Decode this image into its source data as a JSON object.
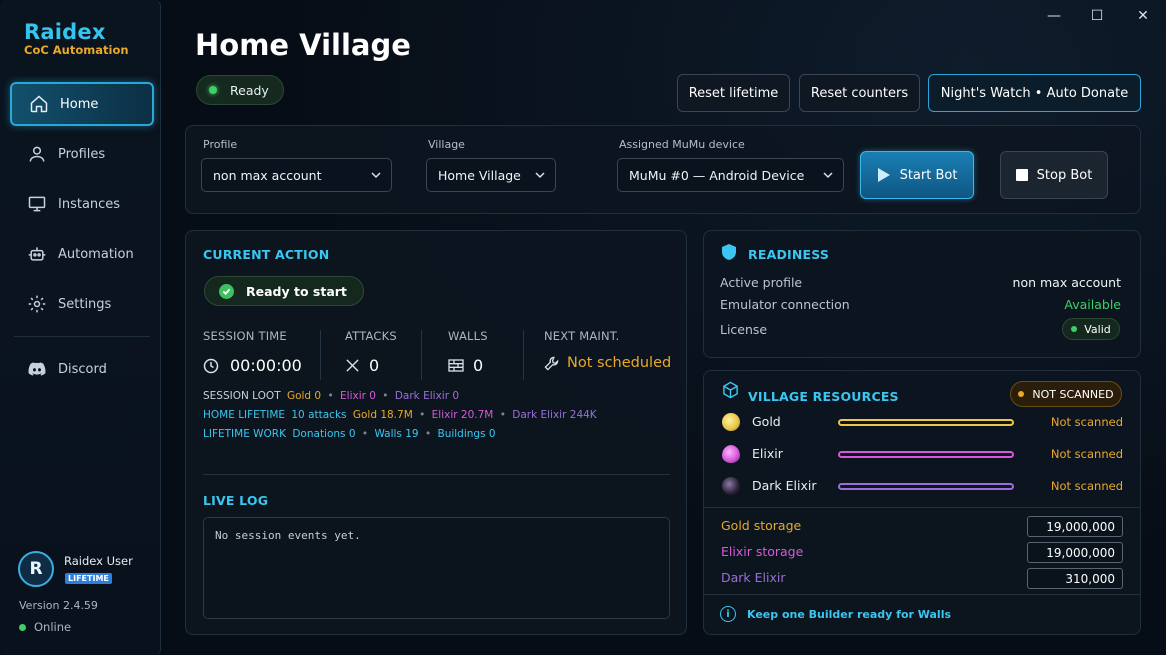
{
  "brand": {
    "name": "Raidex",
    "subtitle": "CoC Automation"
  },
  "nav": {
    "items": [
      {
        "label": "Home",
        "icon": "home-icon",
        "active": true
      },
      {
        "label": "Profiles",
        "icon": "user-icon"
      },
      {
        "label": "Instances",
        "icon": "monitor-icon"
      },
      {
        "label": "Automation",
        "icon": "robot-icon"
      },
      {
        "label": "Settings",
        "icon": "gear-icon"
      }
    ],
    "discord": {
      "label": "Discord",
      "icon": "discord-icon"
    }
  },
  "user": {
    "avatar_letter": "R",
    "name": "Raidex User",
    "badge": "LIFETIME",
    "version": "Version 2.4.59",
    "status": "Online"
  },
  "window": {
    "minimize": "—",
    "maximize": "☐",
    "close": "✕"
  },
  "header": {
    "title": "Home Village",
    "status": "Ready",
    "buttons": {
      "reset_lifetime": "Reset lifetime",
      "reset_counters": "Reset counters",
      "nights_watch": "Night's Watch • Auto Donate"
    }
  },
  "controls": {
    "profile": {
      "label": "Profile",
      "value": "non max account"
    },
    "village": {
      "label": "Village",
      "value": "Home Village"
    },
    "device": {
      "label": "Assigned MuMu device",
      "value": "MuMu #0 — Android Device"
    },
    "start": "Start Bot",
    "stop": "Stop Bot"
  },
  "current_action": {
    "title": "CURRENT ACTION",
    "state": "Ready to start",
    "stats": {
      "session_time": {
        "label": "SESSION TIME",
        "value": "00:00:00"
      },
      "attacks": {
        "label": "ATTACKS",
        "value": "0"
      },
      "walls": {
        "label": "WALLS",
        "value": "0"
      },
      "next_maint": {
        "label": "NEXT MAINT.",
        "value": "Not scheduled"
      }
    },
    "session_loot": {
      "label": "SESSION LOOT",
      "gold": "Gold 0",
      "elixir": "Elixir 0",
      "dark": "Dark Elixir 0"
    },
    "home_lifetime": {
      "label": "HOME LIFETIME",
      "attacks": "10 attacks",
      "gold": "Gold 18.7M",
      "elixir": "Elixir 20.7M",
      "dark": "Dark Elixir 244K"
    },
    "lifetime_work": {
      "label": "LIFETIME WORK",
      "donations": "Donations 0",
      "walls": "Walls 19",
      "buildings": "Buildings 0"
    },
    "separator": "•"
  },
  "live_log": {
    "title": "LIVE LOG",
    "text": "No session events yet."
  },
  "readiness": {
    "title": "READINESS",
    "active_profile": {
      "label": "Active profile",
      "value": "non max account"
    },
    "emulator": {
      "label": "Emulator connection",
      "value": "Available"
    },
    "license": {
      "label": "License",
      "value": "Valid"
    }
  },
  "resources": {
    "title": "VILLAGE RESOURCES",
    "scan_state": "NOT SCANNED",
    "items": [
      {
        "name": "Gold",
        "status": "Not scanned",
        "color": "#e9c84a"
      },
      {
        "name": "Elixir",
        "status": "Not scanned",
        "color": "#d65ad8"
      },
      {
        "name": "Dark Elixir",
        "status": "Not scanned",
        "color": "#9a6fd8"
      }
    ],
    "storage": [
      {
        "label": "Gold storage",
        "value": "19,000,000",
        "color": "#e9c84a"
      },
      {
        "label": "Elixir storage",
        "value": "19,000,000",
        "color": "#d65ad8"
      },
      {
        "label": "Dark Elixir",
        "value": "310,000",
        "color": "#9a6fd8"
      }
    ],
    "tip": "Keep one Builder ready for Walls"
  },
  "colors": {
    "accent": "#3ac6f0",
    "gold": "#e8a928",
    "green": "#3ecf6a",
    "elixir": "#d65ad8",
    "dark": "#9a6fd8"
  }
}
